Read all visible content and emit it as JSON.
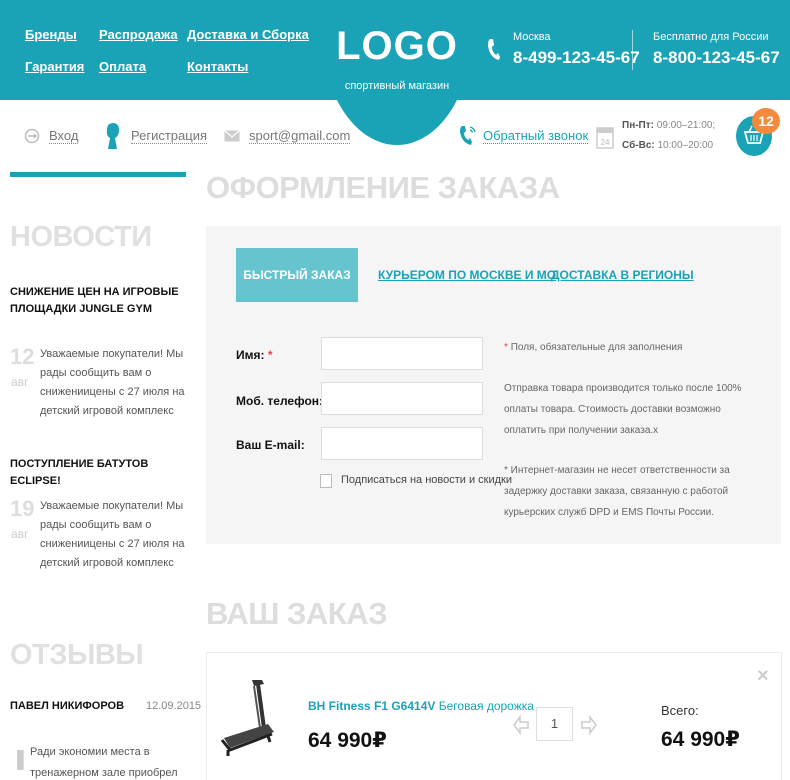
{
  "header": {
    "nav": [
      "Бренды",
      "Распродажа",
      "Доставка и Сборка",
      "Гарантия",
      "Оплата",
      "Контакты"
    ],
    "logo": "LOGO",
    "logo_sub": "спортивный магазин",
    "contacts": [
      {
        "city": "Москва",
        "phone": "8-499-123-45-67"
      },
      {
        "city": "Бесплатно для России",
        "phone": "8-800-123-45-67"
      }
    ]
  },
  "subbar": {
    "login": "Вход",
    "register": "Регистрация",
    "email": "sport@gmail.com",
    "callback": "Обратный звонок",
    "calendar_day": "24",
    "hours": [
      {
        "days": "Пн-Пт:",
        "time": "09:00–21:00;"
      },
      {
        "days": "Сб-Вс:",
        "time": "10:00–20:00"
      }
    ],
    "cart_count": "12"
  },
  "sidebar": {
    "news_title": "НОВОСТИ",
    "news": [
      {
        "title": "СНИЖЕНИЕ ЦЕН НА ИГРОВЫЕ ПЛОЩАДКИ JUNGLE GYM",
        "day": "12",
        "month": "авг",
        "text": "Уважаемые покупатели! Мы рады сообщить вам о снижениицены с 27 июля на детский игровой комплекс"
      },
      {
        "title": "ПОСТУПЛЕНИЕ БАТУТОВ ECLIPSE!",
        "day": "19",
        "month": "авг",
        "text": "Уважаемые покупатели! Мы рады сообщить вам о снижениицены с 27 июля на детский игровой комплекс"
      }
    ],
    "reviews_title": "ОТЗЫВЫ",
    "review": {
      "name": "ПАВЕЛ НИКИФОРОВ",
      "date": "12.09.2015",
      "text": "Ради экономии места в тренажерном зале приобрел многофункциональный"
    }
  },
  "checkout": {
    "title": "ОФОРМЛЕНИЕ ЗАКАЗА",
    "tabs": [
      "БЫСТРЫЙ ЗАКАЗ",
      "КУРЬЕРОМ ПО МОСКВЕ И МО",
      "ДОСТАВКА В РЕГИОНЫ"
    ],
    "fields": [
      {
        "label": "Имя:",
        "required": "*"
      },
      {
        "label": "Моб. телефон:",
        "required": "*"
      },
      {
        "label": "Ваш E-mail:",
        "required": ""
      }
    ],
    "subscribe_label": "Подписаться на новости и скидки",
    "required_note": "Поля, обязательные для заполнения",
    "info_text": "Отправка товара производится только после 100% оплаты товара. Стоимость доставки возможно оплатить при получении заказа.x",
    "disclaimer": "* Интернет-магазин не несет ответственности за задержку доставки заказа, связанную с работой курьерских служб DPD и EMS Почты России."
  },
  "order": {
    "title": "ВАШ ЗАКАЗ",
    "item": {
      "brand": "BH Fitness F1 G6414V",
      "name": "Беговая дорожка",
      "price": "64 990₽",
      "qty": "1"
    },
    "total_label": "Всего:",
    "total_value": "64 990₽",
    "remove": "×"
  },
  "colors": {
    "accent": "#1aa3b6",
    "tab_active": "#66c4cf",
    "badge": "#f58a3c",
    "required": "#e04444"
  },
  "icons": [
    "phone-icon",
    "login-icon",
    "user-icon",
    "mail-icon",
    "callback-phone-icon",
    "calendar-icon",
    "cart-icon",
    "treadmill-image",
    "qty-left-arrow-icon",
    "qty-right-arrow-icon",
    "quote-icon",
    "close-icon"
  ]
}
